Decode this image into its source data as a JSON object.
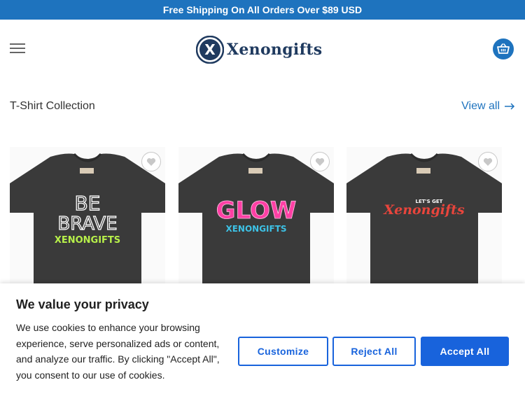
{
  "topbar": {
    "text": "Free Shipping On All Orders Over $89 USD"
  },
  "header": {
    "logo_text": "Xenongifts",
    "logo_mark": "X",
    "menu_icon": "hamburger-icon",
    "cart_icon": "basket-icon"
  },
  "section": {
    "title": "T-Shirt Collection",
    "view_all": "View all"
  },
  "products": [
    {
      "line1": "BE",
      "line2": "BRAVE",
      "line3": "XENONGIFTS",
      "icon": "heart-icon"
    },
    {
      "line1": "GLOW",
      "line2": "XENONGIFTS",
      "icon": "heart-icon"
    },
    {
      "line1": "LET'S GET",
      "line2": "Xenongifts",
      "icon": "heart-icon"
    }
  ],
  "cookie": {
    "title": "We value your privacy",
    "text": "We use cookies to enhance your browsing experience, serve personalized ads or content, and analyze our traffic. By clicking \"Accept All\", you consent to our use of cookies.",
    "customize": "Customize",
    "reject": "Reject All",
    "accept": "Accept All"
  },
  "colors": {
    "brand": "#1e73be",
    "cookie_accent": "#1863dc",
    "shirt": "#3a3a3a"
  }
}
